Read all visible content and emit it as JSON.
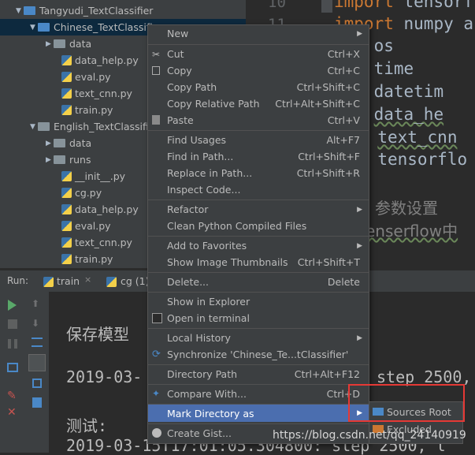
{
  "project_tree": {
    "items": [
      {
        "label": "Tangyudi_TextClassifier",
        "type": "folder",
        "expanded": true
      },
      {
        "label": "Chinese_TextClassifier",
        "type": "folder",
        "expanded": true
      },
      {
        "label": "data",
        "type": "folder",
        "expanded": false
      },
      {
        "label": "data_help.py",
        "type": "py"
      },
      {
        "label": "eval.py",
        "type": "py"
      },
      {
        "label": "text_cnn.py",
        "type": "py"
      },
      {
        "label": "train.py",
        "type": "py"
      },
      {
        "label": "English_TextClassifier",
        "type": "folder",
        "expanded": true
      },
      {
        "label": "data",
        "type": "folder",
        "expanded": false
      },
      {
        "label": "runs",
        "type": "folder",
        "expanded": false
      },
      {
        "label": "__init__.py",
        "type": "py"
      },
      {
        "label": "cg.py",
        "type": "py"
      },
      {
        "label": "data_help.py",
        "type": "py"
      },
      {
        "label": "eval.py",
        "type": "py"
      },
      {
        "label": "text_cnn.py",
        "type": "py"
      },
      {
        "label": "train.py",
        "type": "py"
      }
    ]
  },
  "editor": {
    "line_numbers": [
      "10",
      "11"
    ],
    "lines": [
      {
        "kw": "import",
        "text": "tensorf"
      },
      {
        "kw": "import",
        "text": "numpy a"
      },
      {
        "kw": "ort",
        "text": "os"
      },
      {
        "kw": "ort",
        "text": "time"
      },
      {
        "kw": "ort",
        "text": "datetim"
      },
      {
        "kw": "ort",
        "text": "data_he"
      },
      {
        "kw": "n",
        "text": "text_cnn"
      },
      {
        "kw": "n",
        "text": "tensorflo"
      }
    ],
    "comment": "参数设置",
    "partial": "enserflow中"
  },
  "run_panel": {
    "label": "Run:",
    "tabs": [
      "train",
      "cg (1)"
    ],
    "console": [
      "保存模型",
      "2019-03-",
      "测试:",
      "2019-03-15T17:01:05.304800: step 2500, l"
    ],
    "console_right": "step 2500, l"
  },
  "context_menu": {
    "items": [
      {
        "label": "New",
        "shortcut": "",
        "submenu": true
      },
      {
        "label": "Cut",
        "shortcut": "Ctrl+X",
        "icon": "cut-icon"
      },
      {
        "label": "Copy",
        "shortcut": "Ctrl+C",
        "icon": "copy-icon"
      },
      {
        "label": "Copy Path",
        "shortcut": "Ctrl+Shift+C"
      },
      {
        "label": "Copy Relative Path",
        "shortcut": "Ctrl+Alt+Shift+C"
      },
      {
        "label": "Paste",
        "shortcut": "Ctrl+V",
        "icon": "paste-icon"
      },
      {
        "label": "Find Usages",
        "shortcut": "Alt+F7"
      },
      {
        "label": "Find in Path...",
        "shortcut": "Ctrl+Shift+F"
      },
      {
        "label": "Replace in Path...",
        "shortcut": "Ctrl+Shift+R"
      },
      {
        "label": "Inspect Code...",
        "shortcut": ""
      },
      {
        "label": "Refactor",
        "shortcut": "",
        "submenu": true
      },
      {
        "label": "Clean Python Compiled Files",
        "shortcut": ""
      },
      {
        "label": "Add to Favorites",
        "shortcut": "",
        "submenu": true
      },
      {
        "label": "Show Image Thumbnails",
        "shortcut": "Ctrl+Shift+T"
      },
      {
        "label": "Delete...",
        "shortcut": "Delete"
      },
      {
        "label": "Show in Explorer",
        "shortcut": ""
      },
      {
        "label": "Open in terminal",
        "shortcut": "",
        "icon": "terminal-icon"
      },
      {
        "label": "Local History",
        "shortcut": "",
        "submenu": true
      },
      {
        "label": "Synchronize 'Chinese_Te...tClassifier'",
        "shortcut": "",
        "icon": "sync-icon"
      },
      {
        "label": "Directory Path",
        "shortcut": "Ctrl+Alt+F12"
      },
      {
        "label": "Compare With...",
        "shortcut": "Ctrl+D",
        "icon": "compare-icon"
      },
      {
        "label": "Mark Directory as",
        "shortcut": "",
        "submenu": true,
        "highlighted": true
      },
      {
        "label": "Create Gist...",
        "shortcut": "",
        "icon": "github-icon"
      }
    ]
  },
  "submenu": {
    "items": [
      {
        "label": "Sources Root",
        "color": "#4a88c7"
      },
      {
        "label": "Excluded",
        "color": "#cc7832"
      }
    ]
  },
  "watermark": "https://blog.csdn.net/qq_24140919"
}
